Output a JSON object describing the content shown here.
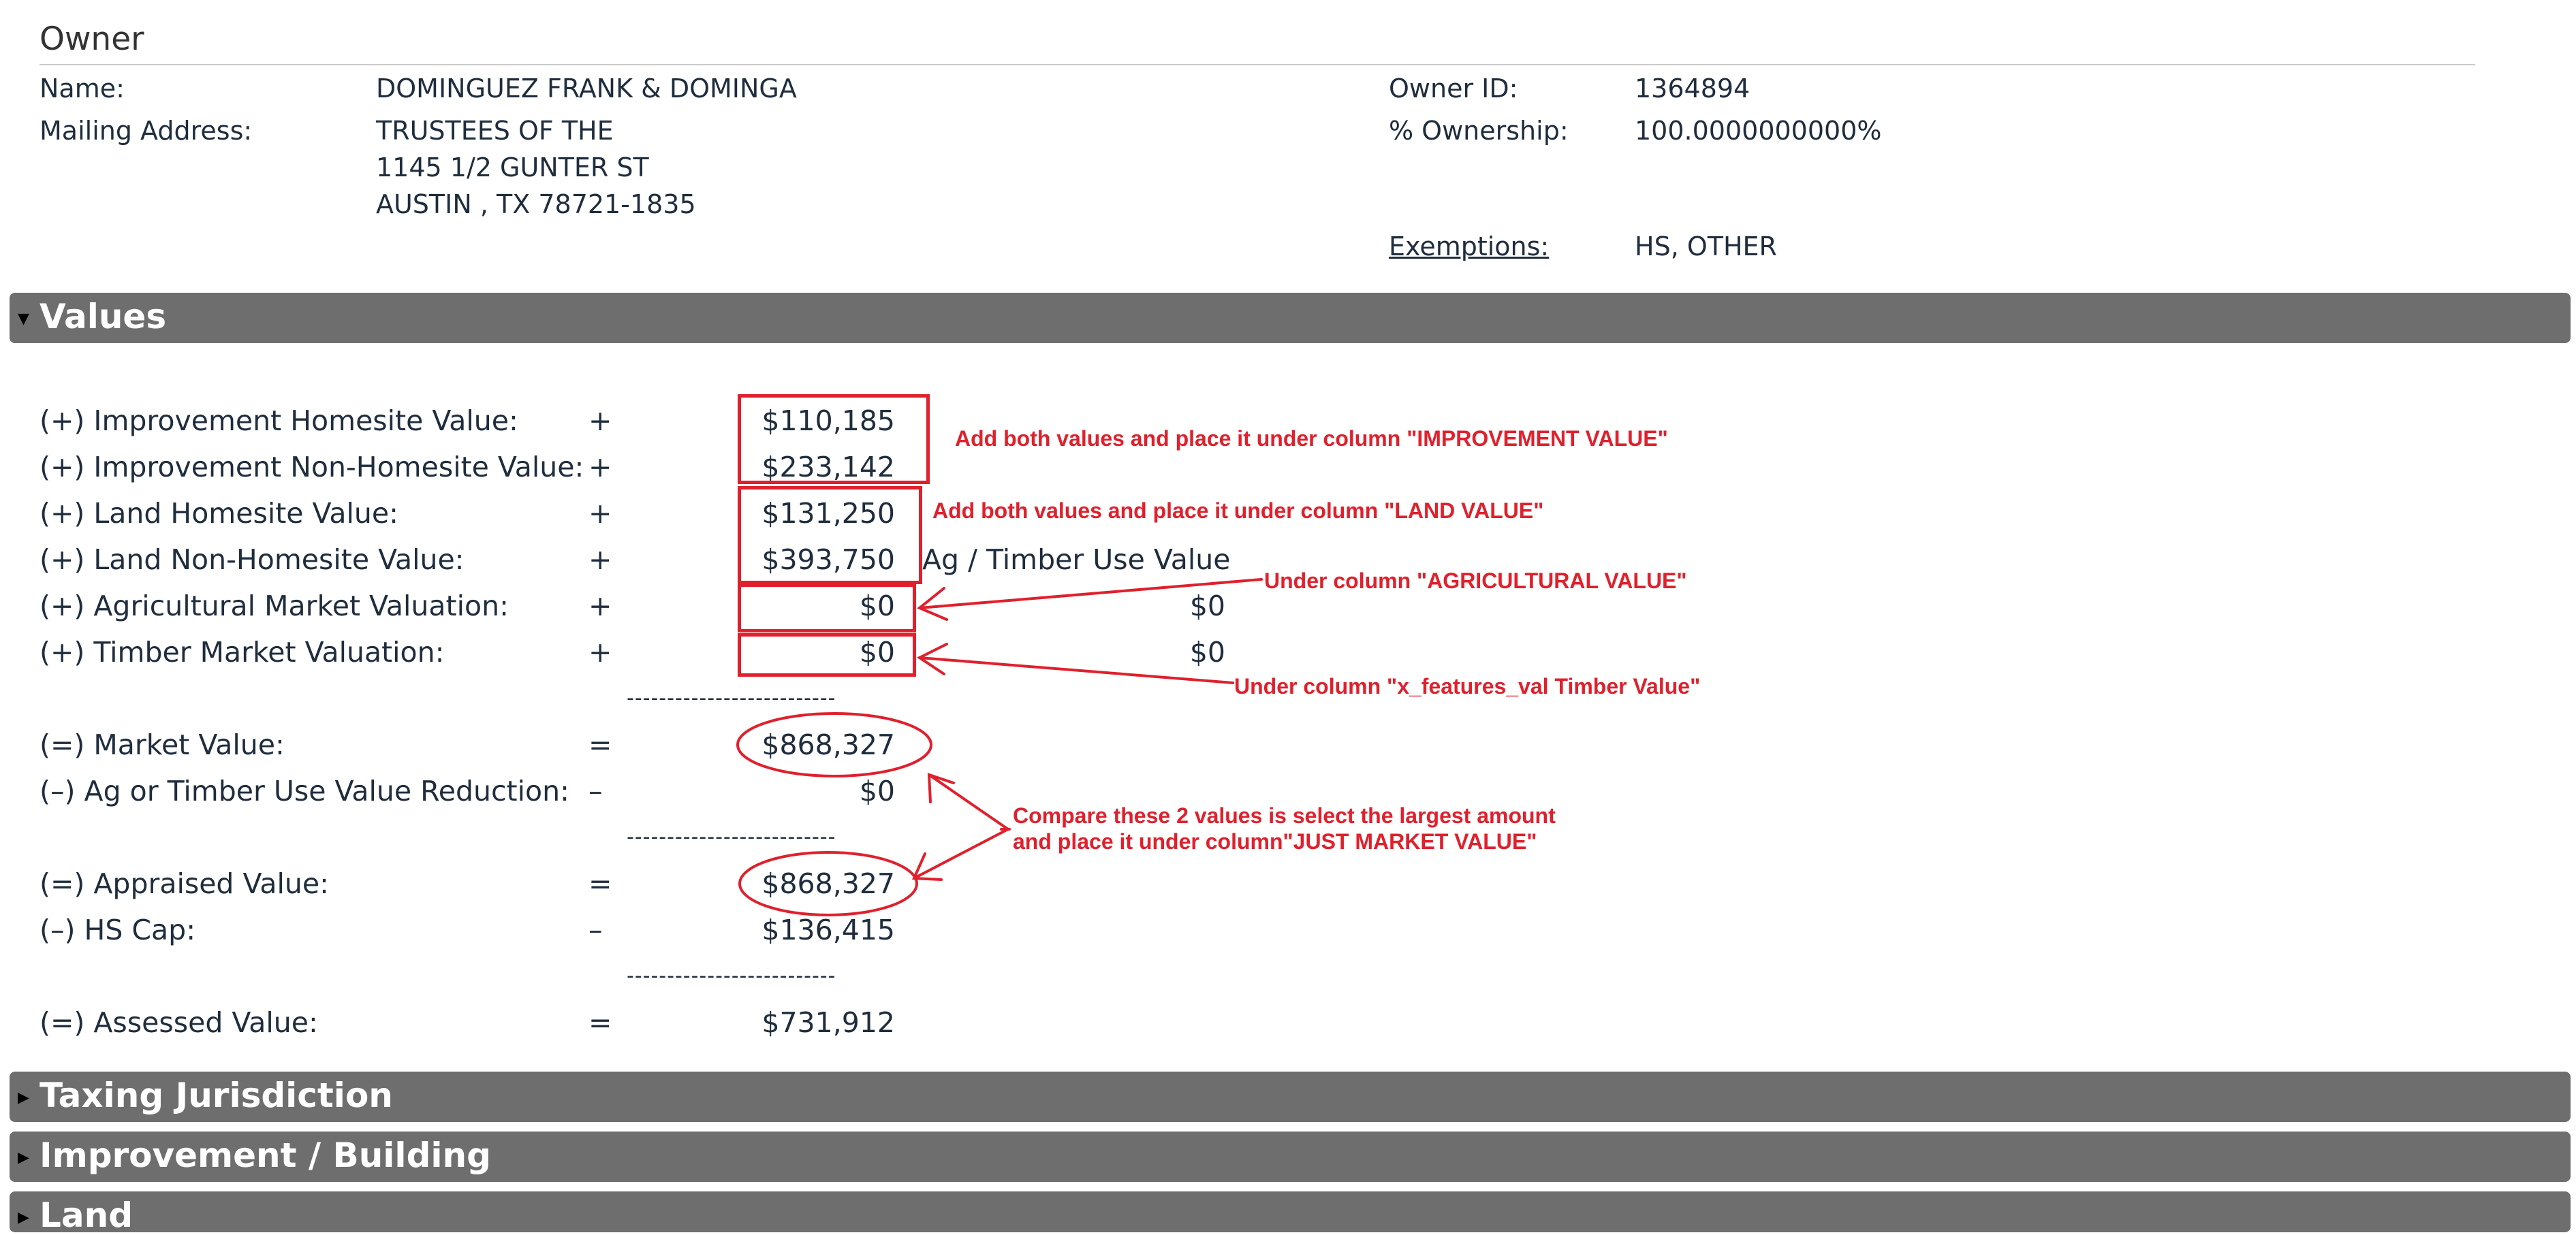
{
  "owner": {
    "heading": "Owner",
    "name_label": "Name:",
    "name_value": "DOMINGUEZ FRANK & DOMINGA",
    "mailing_label": "Mailing Address:",
    "mailing_lines": [
      "TRUSTEES OF THE",
      "1145 1/2 GUNTER ST",
      "AUSTIN , TX 78721-1835"
    ],
    "owner_id_label": "Owner ID:",
    "owner_id_value": "1364894",
    "ownership_label": "% Ownership:",
    "ownership_value": "100.0000000000%",
    "exemptions_label": "Exemptions:",
    "exemptions_value": "HS, OTHER"
  },
  "sections": {
    "values": "Values",
    "taxing": "Taxing Jurisdiction",
    "improvement": "Improvement / Building",
    "land": "Land"
  },
  "values": {
    "rows": [
      {
        "label": "(+) Improvement Homesite Value:",
        "op": "+",
        "amount": "$110,185"
      },
      {
        "label": "(+) Improvement Non-Homesite Value:",
        "op": "+",
        "amount": "$233,142"
      },
      {
        "label": "(+) Land Homesite Value:",
        "op": "+",
        "amount": "$131,250"
      },
      {
        "label": "(+) Land Non-Homesite Value:",
        "op": "+",
        "amount": "$393,750"
      },
      {
        "label": "(+) Agricultural Market Valuation:",
        "op": "+",
        "amount": "$0"
      },
      {
        "label": "(+) Timber Market Valuation:",
        "op": "+",
        "amount": "$0"
      },
      {
        "label": "(=) Market Value:",
        "op": "=",
        "amount": "$868,327"
      },
      {
        "label": "(–) Ag or Timber Use Value Reduction:",
        "op": "–",
        "amount": "$0"
      },
      {
        "label": "(=) Appraised Value:",
        "op": "=",
        "amount": "$868,327"
      },
      {
        "label": "(–) HS Cap:",
        "op": "–",
        "amount": "$136,415"
      },
      {
        "label": "(=) Assessed Value:",
        "op": "=",
        "amount": "$731,912"
      }
    ],
    "ag_header": "Ag / Timber Use Value",
    "ag_value": "$0",
    "timber_value": "$0",
    "divider": "--------------------------"
  },
  "annotations": {
    "improvement": "Add both values and place it under column \"IMPROVEMENT VALUE\"",
    "land": "Add both values and place it under column \"LAND VALUE\"",
    "agricultural": "Under column \"AGRICULTURAL VALUE\"",
    "timber": "Under column \"x_features_val Timber Value\"",
    "compare_line1": "Compare these 2 values is select the largest amount",
    "compare_line2": "and place it under column\"JUST MARKET VALUE\"",
    "color": "#e0202c"
  }
}
